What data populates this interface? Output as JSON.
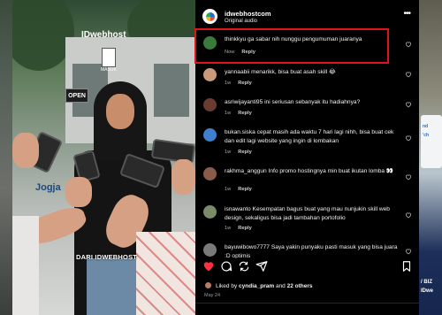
{
  "video": {
    "watermark": "IDwebhost",
    "qr_label": "MASUK",
    "sign": "OPEN",
    "storefront_text": "Jogja",
    "caption": "DARI IDWEBHOST"
  },
  "post": {
    "account": "idwebhostcom",
    "audio": "Original audio"
  },
  "comments": [
    {
      "user": "thinkkyu",
      "text": "ga sabar nih nunggu pengumuman juaranya",
      "time": "Now",
      "reply": "Reply",
      "avatar_color": "#3a7a3a"
    },
    {
      "user": "yannaabii",
      "text": "menarikk, bisa buat asah skill 😂",
      "time": "1w",
      "reply": "Reply",
      "avatar_color": "#c89a7a"
    },
    {
      "user": "asriwijayanti95",
      "text": "ini seriusan sebanyak itu hadiahnya?",
      "time": "1w",
      "reply": "Reply",
      "avatar_color": "#6a3c30"
    },
    {
      "user": "bukan.siska",
      "text": "cepat masih ada waktu 7 hari lagi nihh, bisa buat cek dan edit lagi website yang ingin di lombakan",
      "time": "1w",
      "reply": "Reply",
      "avatar_color": "#3e7fd0"
    },
    {
      "user": "rakhma_anggun",
      "text": "Info promo hostingnya min buat ikutan lomba 👀",
      "time": "1w",
      "reply": "Reply",
      "avatar_color": "#8a5a4a"
    },
    {
      "user": "isnawanto",
      "text": "Kesempatan bagus buat yang mau nunjukin skill web design, sekaligus bisa jadi tambahan portofolio",
      "time": "1w",
      "reply": "Reply",
      "avatar_color": "#7a8a6a"
    },
    {
      "user": "bayuwibowo7777",
      "text": "Saya yakin punyaku pasti masuk yang bisa juara :D optimis",
      "time": "1w",
      "reply": "Reply",
      "avatar_color": "#7a7a7a"
    }
  ],
  "likes": {
    "prefix": "Liked by",
    "user": "cyndia_pram",
    "connector": "and",
    "others": "22 others"
  },
  "date": "May 24",
  "right_peek": {
    "text1": "nd",
    "text2": "'ch",
    "text3": "/ BIZ",
    "text4": "IDwe"
  },
  "colors": {
    "highlight": "#e0141b",
    "liked_heart": "#ff3040",
    "panel_bg": "#000000"
  }
}
